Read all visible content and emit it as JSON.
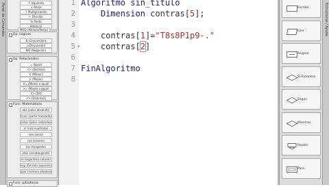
{
  "left_panel": {
    "tab_label": "Panel de Comandos",
    "top_ops": [
      "↑ Izquierda",
      "↓ Abajo",
      "↑ Multiplicación",
      "← División",
      "% Resto",
      "Potencia",
      "MOD (Módulo/Resto)"
    ],
    "groups": [
      {
        "title": "Op. Lógicos",
        "ops": [
          "& (Conjunción)",
          "| (Disyunción)",
          "NO (Negación)"
        ]
      },
      {
        "title": "Op. Relacionales",
        "ops": [
          "= (Igual)",
          "<> (Distinto)",
          "< (Menor)",
          "> (Mayor)",
          "<= (Menor o igual)",
          ">= (Mayor o igual)",
          "<> (Dif)",
          "<> (Distinto2)"
        ]
      },
      {
        "title": "Func. Matemáticas",
        "ops": [
          "abs (valor absoluto)",
          "trunc (parte truncada)",
          "redon (valor redondeado)",
          "rc (raíz cuadrada)",
          "sen (seno)",
          "cos (coseno)",
          "tan (tangente)",
          "atan (arcotangente)",
          "ln (logaritmo natural)",
          "exp (función exponencial)",
          "azar (número aleatorio)"
        ]
      },
      {
        "title": "Func. p/Cadenas",
        "ops": []
      }
    ]
  },
  "editor": {
    "lines": [
      {
        "num": "1",
        "fold": "",
        "parts": [
          {
            "t": "Algoritmo ",
            "c": "kw"
          },
          {
            "t": "sin_titulo",
            "c": "kw"
          }
        ]
      },
      {
        "num": "2",
        "fold": "",
        "parts": [
          {
            "t": "    Dimension ",
            "c": "kw"
          },
          {
            "t": "contras[",
            "c": ""
          },
          {
            "t": "5",
            "c": "idx"
          },
          {
            "t": "];",
            "c": ""
          }
        ]
      },
      {
        "num": "3",
        "fold": "",
        "parts": []
      },
      {
        "num": "4",
        "fold": "",
        "parts": [
          {
            "t": "    contras[",
            "c": ""
          },
          {
            "t": "1",
            "c": "idx"
          },
          {
            "t": "]=",
            "c": ""
          },
          {
            "t": "\"T8s8P1p9-.\"",
            "c": "str"
          }
        ]
      },
      {
        "num": "5",
        "fold": "▾",
        "parts": [
          {
            "t": "    contras[",
            "c": ""
          },
          {
            "t": "2",
            "c": "idx"
          },
          {
            "t": "]",
            "c": ""
          }
        ]
      },
      {
        "num": "6",
        "fold": "",
        "parts": []
      },
      {
        "num": "7",
        "fold": "",
        "parts": [
          {
            "t": "FinAlgoritmo",
            "c": "kw"
          }
        ]
      },
      {
        "num": "8",
        "fold": "",
        "parts": []
      }
    ]
  },
  "right_panel": {
    "tab_label": "Estructuras / Ayuda",
    "items": [
      {
        "label": "Escribir",
        "icon": "write-icon"
      },
      {
        "label": "Leer",
        "icon": "read-icon"
      },
      {
        "label": "Asignar",
        "icon": "assign-icon"
      },
      {
        "label": "Si-Entonces",
        "icon": "if-icon"
      },
      {
        "label": "Según",
        "icon": "switch-icon"
      },
      {
        "label": "Mientras",
        "icon": "while-icon"
      },
      {
        "label": "Repetir",
        "icon": "repeat-icon"
      },
      {
        "label": "Para",
        "icon": "for-icon"
      }
    ]
  }
}
